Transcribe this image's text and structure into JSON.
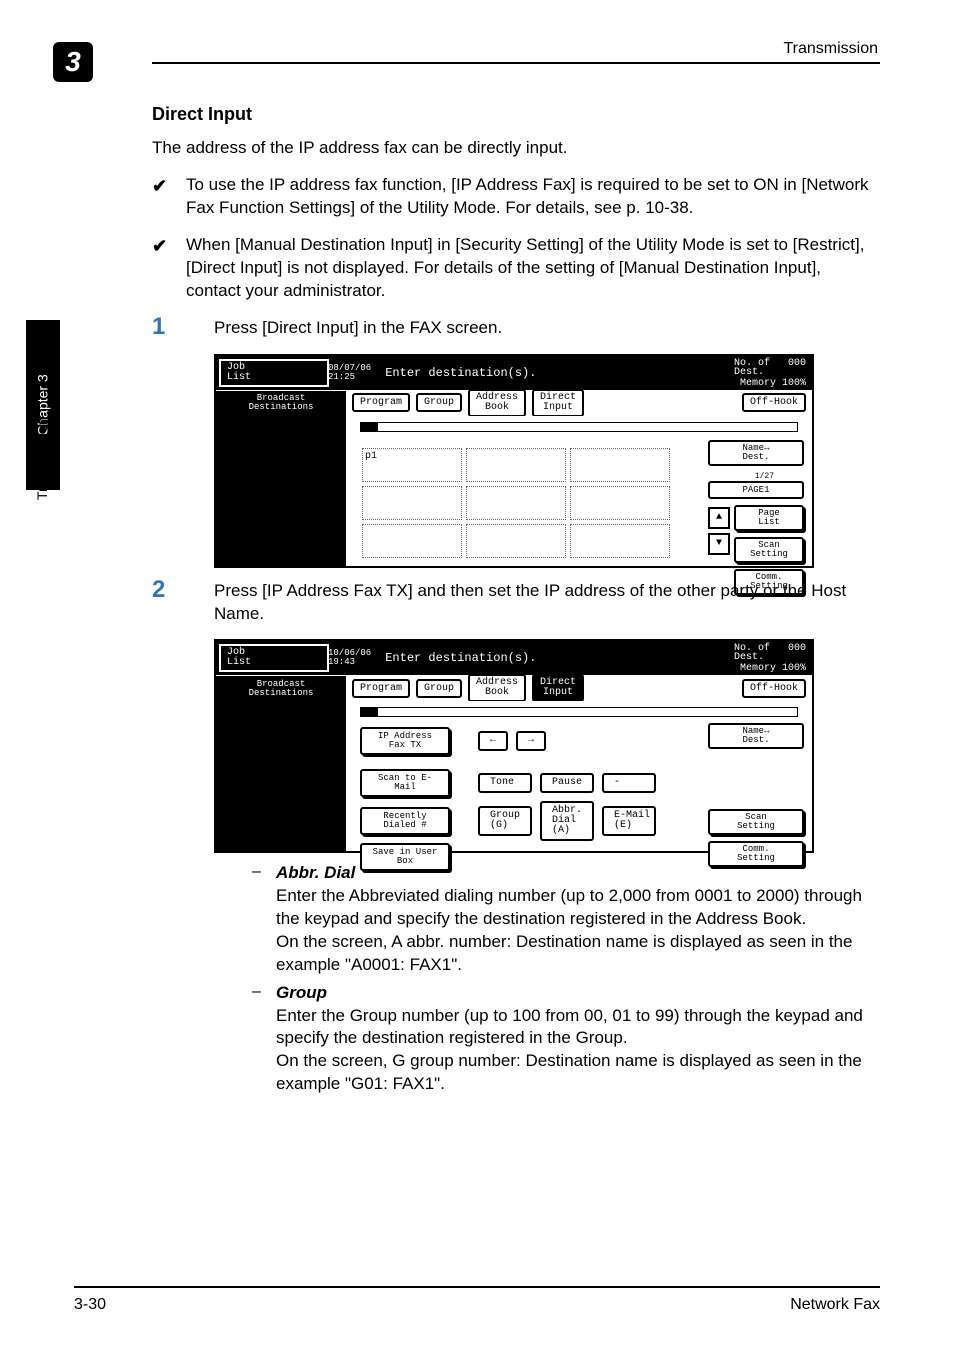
{
  "header": {
    "chapter_number": "3",
    "title": "Transmission"
  },
  "sidetab": {
    "label": "Chapter 3",
    "vertical_text": "Transmission"
  },
  "section": {
    "title": "Direct Input",
    "lead": "The address of the IP address fax can be directly input."
  },
  "bullets": [
    "To use the IP address fax function, [IP Address Fax] is required to be set to ON in [Network Fax Function Settings] of the Utility Mode. For details, see p. 10-38.",
    "When [Manual Destination Input] in [Security Setting] of the Utility Mode is set to [Restrict], [Direct Input] is not displayed. For details of the setting of [Manual Destination Input], contact your administrator."
  ],
  "steps": {
    "s1": {
      "num": "1",
      "text": "Press [Direct Input] in the FAX screen."
    },
    "s2": {
      "num": "2",
      "text": "Press [IP Address Fax TX] and then set the IP address of the other party or the Host Name."
    }
  },
  "shot1": {
    "joblist_top": "Job",
    "joblist_bottom": "List",
    "date": "08/07/06",
    "time": "21:25",
    "instruction": "Enter destination(s).",
    "noof": "No. of",
    "dest": "Dest.",
    "count": "000",
    "memory": "Memory 100%",
    "bd1": "Broadcast",
    "bd2": "Destinations",
    "tabs": {
      "program": "Program",
      "group": "Group",
      "address": "Address\nBook",
      "direct": "Direct\nInput",
      "offhook": "Off-Hook"
    },
    "cell": "p1",
    "right": {
      "name": "Name↔\nDest.",
      "page1": "PAGE1",
      "pagelist": "Page\nList",
      "scan": "Scan\nSetting",
      "comm": "Comm.\nSetting"
    },
    "fraction": "1/27"
  },
  "shot2": {
    "date": "10/06/06",
    "time": "19:43",
    "btns": {
      "ip": "IP Address\nFax TX",
      "scan_email": "Scan to\nE-Mail",
      "recently": "Recently\nDialed #",
      "save": "Save in\nUser Box",
      "tone": "Tone",
      "pause": "Pause",
      "dash": "-",
      "group": "Group\n(G)",
      "abbr": "Abbr.\nDial\n(A)",
      "email": "E-Mail\n(E)",
      "left": "←",
      "right": "→"
    },
    "right": {
      "name": "Name↔\nDest.",
      "scan": "Scan\nSetting",
      "comm": "Comm.\nSetting"
    }
  },
  "defs": {
    "abbr": {
      "term": "Abbr. Dial",
      "desc": "Enter the Abbreviated dialing number (up to 2,000 from 0001 to 2000) through the keypad and specify the destination registered in the Address Book.\nOn the screen, A abbr. number: Destination name is displayed as seen in the example \"A0001: FAX1\"."
    },
    "group": {
      "term": "Group",
      "desc": "Enter the Group number (up to 100 from 00, 01 to 99) through the keypad and specify the destination registered in the Group.\nOn the screen, G group number: Destination name is displayed as seen in the example \"G01: FAX1\"."
    }
  },
  "footer": {
    "left": "3-30",
    "right": "Network Fax"
  }
}
